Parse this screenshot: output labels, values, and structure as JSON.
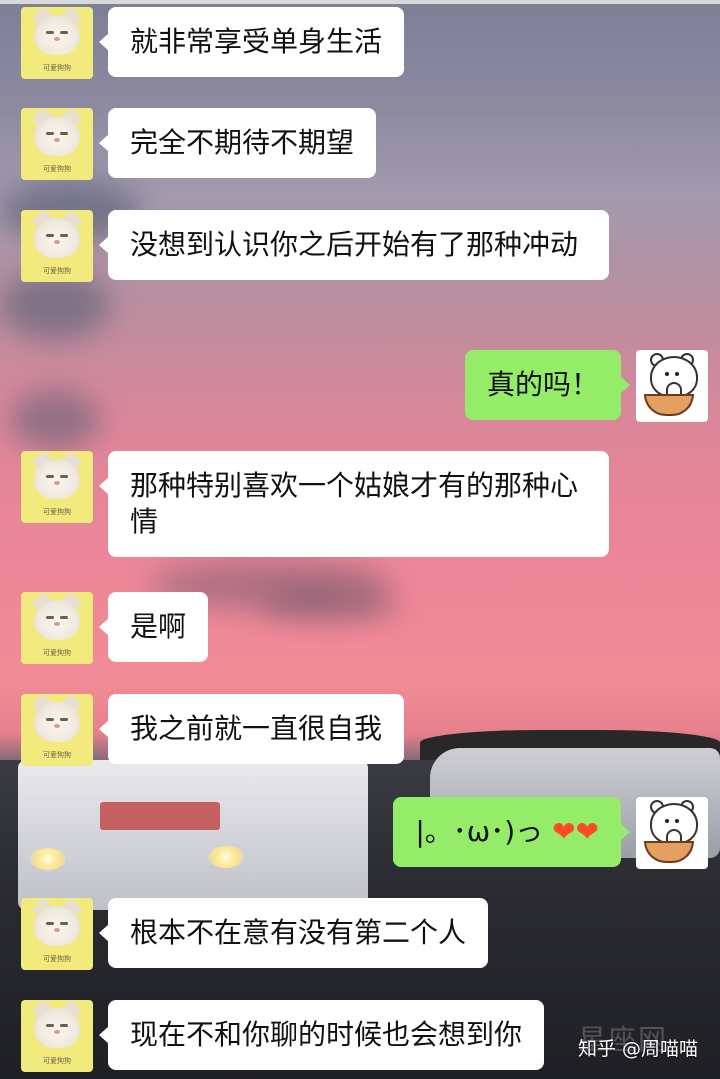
{
  "colors": {
    "incoming_bubble": "#ffffff",
    "outgoing_bubble": "#95ec69",
    "text": "#111111",
    "heart": "#ff4a2a",
    "avatar_bg": "#f3ea7e"
  },
  "chat": {
    "messages": [
      {
        "side": "left",
        "text": "就非常享受单身生活",
        "avatar_icon": "cat-avatar-icon",
        "avatar_caption": "可爱狗狗"
      },
      {
        "side": "left",
        "text": "完全不期待不期望",
        "avatar_icon": "cat-avatar-icon",
        "avatar_caption": "可爱狗狗"
      },
      {
        "side": "left",
        "text": "没想到认识你之后开始有了那种冲动",
        "avatar_icon": "cat-avatar-icon",
        "avatar_caption": "可爱狗狗"
      },
      {
        "side": "right",
        "text": "真的吗！",
        "avatar_icon": "bear-avatar-icon"
      },
      {
        "side": "left",
        "text": "那种特别喜欢一个姑娘才有的那种心情",
        "avatar_icon": "cat-avatar-icon",
        "avatar_caption": "可爱狗狗"
      },
      {
        "side": "left",
        "text": "是啊",
        "avatar_icon": "cat-avatar-icon",
        "avatar_caption": "可爱狗狗"
      },
      {
        "side": "left",
        "text": "我之前就一直很自我",
        "avatar_icon": "cat-avatar-icon",
        "avatar_caption": "可爱狗狗"
      },
      {
        "side": "right",
        "text": "|。･ω･)っ",
        "emoji": "❤❤",
        "avatar_icon": "bear-avatar-icon"
      },
      {
        "side": "left",
        "text": "根本不在意有没有第二个人",
        "avatar_icon": "cat-avatar-icon",
        "avatar_caption": "可爱狗狗"
      },
      {
        "side": "left",
        "text": "现在不和你聊的时候也会想到你",
        "avatar_icon": "cat-avatar-icon",
        "avatar_caption": "可爱狗狗"
      }
    ]
  },
  "watermark": {
    "text": "知乎 @周喵喵",
    "ghost_text": "星座网"
  }
}
